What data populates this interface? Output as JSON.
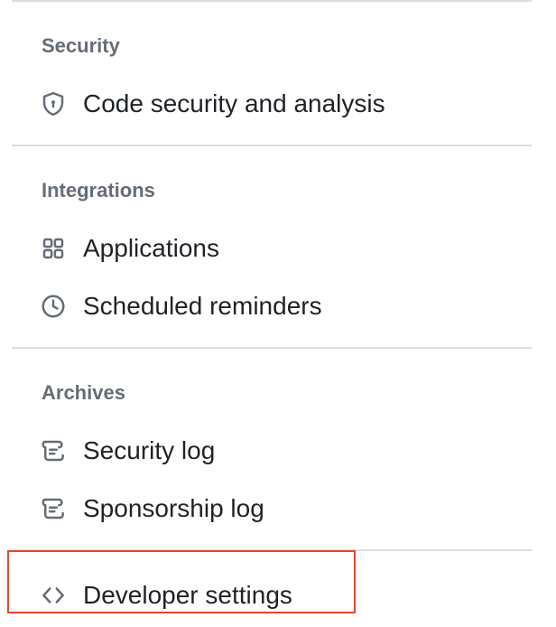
{
  "sections": [
    {
      "heading": "Security",
      "items": [
        {
          "label": "Code security and analysis",
          "icon": "shield-lock-icon"
        }
      ]
    },
    {
      "heading": "Integrations",
      "items": [
        {
          "label": "Applications",
          "icon": "apps-grid-icon"
        },
        {
          "label": "Scheduled reminders",
          "icon": "clock-icon"
        }
      ]
    },
    {
      "heading": "Archives",
      "items": [
        {
          "label": "Security log",
          "icon": "log-icon"
        },
        {
          "label": "Sponsorship log",
          "icon": "log-icon"
        }
      ]
    }
  ],
  "developer": {
    "label": "Developer settings",
    "icon": "code-icon"
  },
  "colors": {
    "heading": "#656d76",
    "text": "#1f2328",
    "divider": "#d8dee4",
    "highlight": "#e8452c"
  }
}
